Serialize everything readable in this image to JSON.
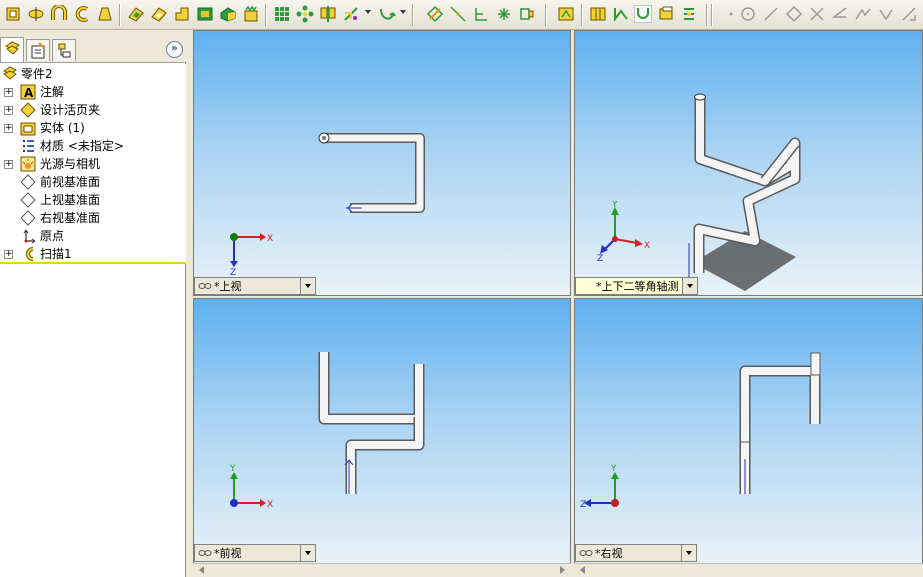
{
  "toolbar": {
    "icons": [
      "extruded-boss-icon",
      "revolved-boss-icon",
      "swept-boss-icon",
      "lofted-boss-icon",
      "extruded-cut-icon",
      "fillet-icon",
      "chamfer-icon",
      "shell-icon",
      "draft-icon",
      "rib-icon",
      "hole-wizard-icon",
      "linear-pattern-icon",
      "circular-pattern-icon",
      "mirror-icon",
      "reference-geometry-icon",
      "curves-icon",
      "sketch-icon",
      "smart-dimension-icon",
      "line-icon",
      "centerline-icon",
      "point-icon",
      "convert-entities-icon",
      "sketch-select-icon",
      "3d-sketch-icon",
      "routing-icon",
      "swept-path-icon",
      "loft-icon",
      "dimension-icon",
      "line-tool-icon",
      "circle-tool-icon",
      "polygon-icon",
      "trim-icon",
      "angle-icon",
      "arc-icon",
      "tangent-icon"
    ]
  },
  "panel": {
    "tabs": [
      "feature-manager-tab",
      "property-manager-tab",
      "configuration-manager-tab"
    ],
    "expand_label": "»"
  },
  "tree": {
    "root": "零件2",
    "items": [
      {
        "label": "注解",
        "expandable": true,
        "icon": "annotations-icon"
      },
      {
        "label": "设计活页夹",
        "expandable": true,
        "icon": "design-binder-icon"
      },
      {
        "label": "实体 (1)",
        "expandable": true,
        "icon": "solid-bodies-icon"
      },
      {
        "label": "材质 <未指定>",
        "expandable": false,
        "icon": "material-icon"
      },
      {
        "label": "光源与相机",
        "expandable": true,
        "icon": "lights-cameras-icon"
      },
      {
        "label": "前视基准面",
        "expandable": false,
        "icon": "plane-icon"
      },
      {
        "label": "上视基准面",
        "expandable": false,
        "icon": "plane-icon"
      },
      {
        "label": "右视基准面",
        "expandable": false,
        "icon": "plane-icon"
      },
      {
        "label": "原点",
        "expandable": false,
        "icon": "origin-icon"
      },
      {
        "label": "扫描1",
        "expandable": true,
        "icon": "sweep-feature-icon"
      }
    ]
  },
  "viewports": {
    "top_left": {
      "label": "*上视",
      "axis_x": "X",
      "axis_z": "Z"
    },
    "top_right": {
      "label": "*上下二等角轴测",
      "axis_x": "X",
      "axis_y": "Y",
      "axis_z": "Z"
    },
    "bottom_left": {
      "label": "*前视",
      "axis_x": "X",
      "axis_y": "Y"
    },
    "bottom_right": {
      "label": "*右视",
      "axis_y": "Y",
      "axis_z": "Z"
    }
  },
  "colors": {
    "axis_x": "#d62020",
    "axis_y": "#20a020",
    "axis_z": "#2030c0",
    "tree_accent": "#e7d700"
  }
}
